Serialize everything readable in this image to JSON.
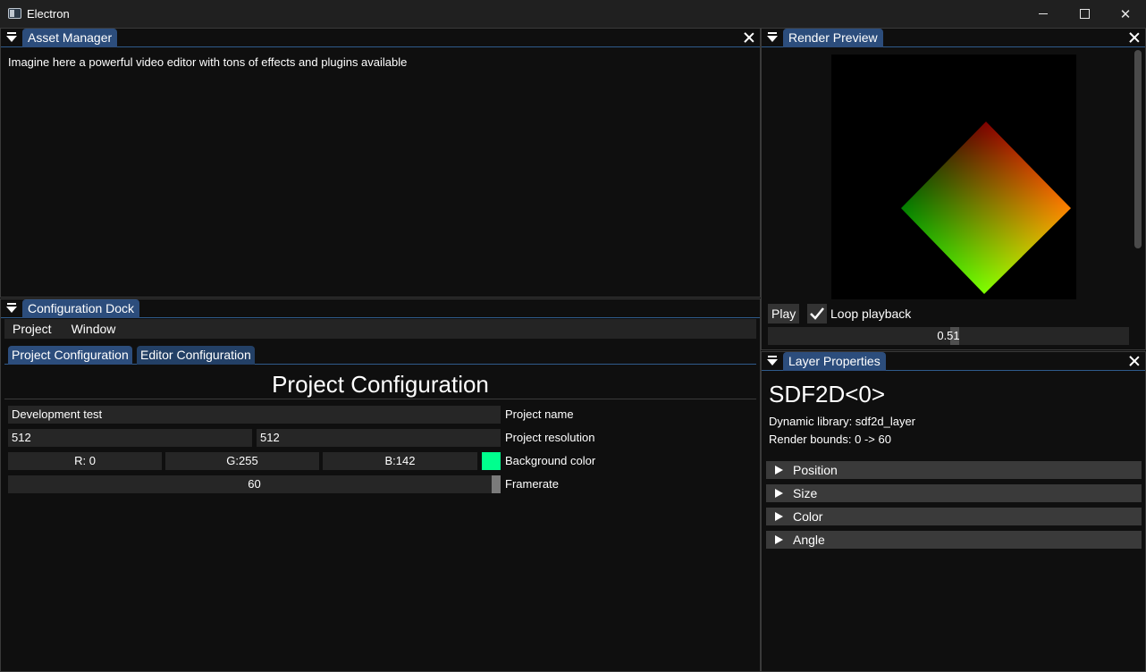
{
  "window": {
    "title": "Electron",
    "minimize_label": "",
    "maximize_label": "",
    "close_label": "✕"
  },
  "asset_manager": {
    "tab": "Asset Manager",
    "text": "Imagine here a powerful video editor with tons of effects and plugins available"
  },
  "config_dock": {
    "tab": "Configuration Dock",
    "menu": [
      "Project",
      "Window"
    ],
    "subtabs": [
      "Project Configuration",
      "Editor Configuration"
    ],
    "heading": "Project Configuration",
    "project_name": {
      "value": "Development test",
      "label": "Project name"
    },
    "resolution": {
      "width": "512",
      "height": "512",
      "label": "Project resolution"
    },
    "background": {
      "r": "R:  0",
      "g": "G:255",
      "b": "B:142",
      "label": "Background color",
      "swatch": "#00ff8e"
    },
    "framerate": {
      "value": "60",
      "label": "Framerate"
    }
  },
  "render_preview": {
    "tab": "Render Preview",
    "play": "Play",
    "loop": "Loop playback",
    "loop_checked": true,
    "time": "0.51"
  },
  "layer_properties": {
    "tab": "Layer Properties",
    "title": "SDF2D<0>",
    "library": "Dynamic library: sdf2d_layer",
    "bounds": "Render bounds: 0 -> 60",
    "sections": [
      "Position",
      "Size",
      "Color",
      "Angle"
    ]
  },
  "colors": {
    "tab_active": "#2c4d7c",
    "tab_inactive": "#234066",
    "accent_line": "#2f5b8c",
    "background_color_swatch": "#00ff8e"
  }
}
